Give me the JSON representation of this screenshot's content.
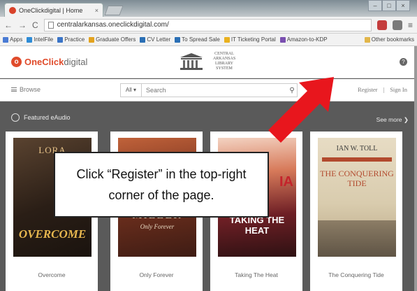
{
  "browser": {
    "tab_title": "OneClickdigital | Home",
    "tab_close": "×",
    "url": "centralarkansas.oneclickdigital.com/",
    "bookmarks": [
      "Apps",
      "IntelFile",
      "Practice",
      "Graduate Offers",
      "CV Letter",
      "To Spread Sale",
      "IT Ticketing Portal",
      "Amazon-to-KDP",
      "Other bookmarks"
    ],
    "back_icon": "←",
    "forward_icon": "→",
    "reload_icon": "C",
    "menu_icon": "≡"
  },
  "site": {
    "logo_one": "OneClick",
    "logo_digital": "digital",
    "logo_letter": "o",
    "library_name_lines": [
      "CENTRAL",
      "ARKANSAS",
      "LIBRARY",
      "SYSTEM"
    ],
    "help_label": "?",
    "browse_label": "Browse",
    "search_scope": "All ▾",
    "search_placeholder": "Search",
    "search_icon_glyph": "⚲",
    "register_label": "Register",
    "separator": "|",
    "signin_label": "Sign In"
  },
  "featured": {
    "heading": "Featured eAudio",
    "see_more": "See more ❯",
    "books": [
      {
        "title": "Overcome",
        "cover_top": "LORA",
        "cover_main": "OVERCOME"
      },
      {
        "title": "Only Forever",
        "cover_main": "MILLER",
        "cover_sub": "Only Forever"
      },
      {
        "title": "Taking The Heat",
        "cover_main": "TAKING THE HEAT",
        "cover_accent": "IA"
      },
      {
        "title": "The Conquering Tide",
        "cover_author": "IAN W. TOLL",
        "cover_main": "THE CONQUERING TIDE"
      }
    ]
  },
  "annotation": {
    "text": "Click “Register” in the top-right corner of the page."
  },
  "colors": {
    "brand": "#e04b2b",
    "arrow": "#e8161d"
  }
}
